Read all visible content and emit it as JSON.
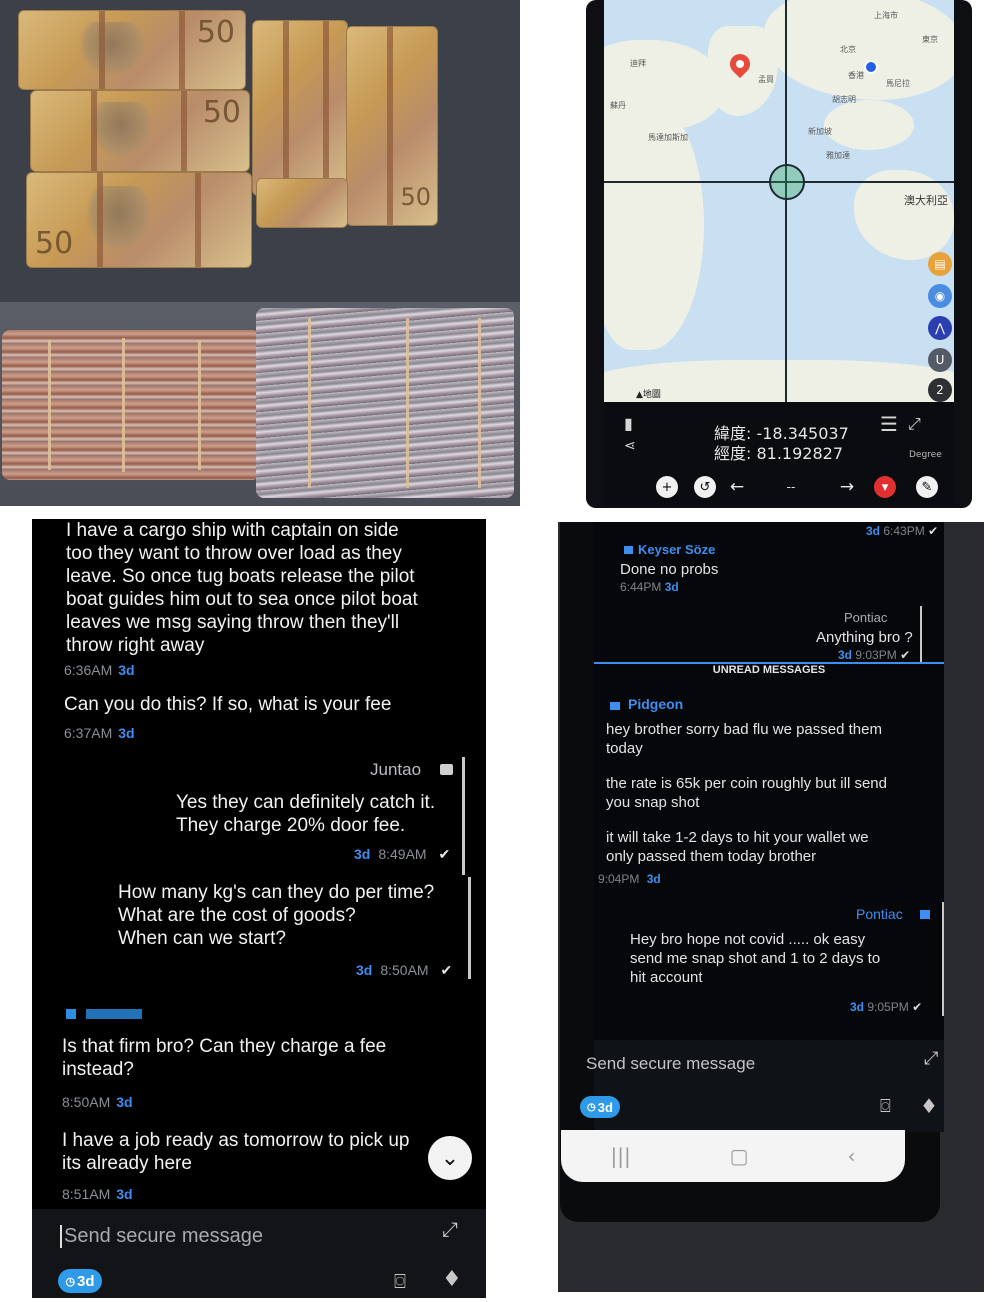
{
  "map": {
    "places": [
      "上海市",
      "東京",
      "北京",
      "香港",
      "胡志明",
      "馬尼拉",
      "新加坡",
      "雅加達",
      "孟買",
      "迪拜",
      "蘇丹",
      "馬達加斯加"
    ],
    "australia_label": "澳大利亞",
    "basemap_label": "▲地圖",
    "latitude_text": "緯度: -18.345037",
    "longitude_text": "經度: 81.192827",
    "degree_label": "Degree",
    "side_buttons": [
      "layers",
      "location",
      "navigate",
      "U",
      "2"
    ],
    "dash_label": "--"
  },
  "chat1": {
    "messages": [
      {
        "lines": [
          "I have a cargo ship with captain on side",
          "too they want to throw over load as they",
          "leave. So once tug boats release the pilot",
          "boat guides him out to sea once pilot boat",
          "leaves we msg saying throw then they'll",
          "throw right away"
        ],
        "time": "6:36AM",
        "ago": "3d"
      },
      {
        "lines": [
          "Can you do this? If so, what is your fee"
        ],
        "time": "6:37AM",
        "ago": "3d"
      },
      {
        "sender": "Juntao",
        "lines": [
          "Yes they can definitely catch it.",
          "They charge 20% door fee."
        ],
        "time": "8:49AM",
        "ago": "3d",
        "status": "✔"
      },
      {
        "lines": [
          "How many kg's can they do per time?",
          "What are the cost of goods?",
          "When can we start?"
        ],
        "time": "8:50AM",
        "ago": "3d",
        "status": "✔"
      },
      {
        "lines": [
          "Is that firm bro? Can they charge a fee",
          "instead?"
        ],
        "time": "8:50AM",
        "ago": "3d"
      },
      {
        "lines": [
          "I have a job ready as tomorrow to pick up",
          "its already here"
        ],
        "time": "8:51AM",
        "ago": "3d"
      }
    ],
    "composer": {
      "placeholder": "Send secure message",
      "timer_badge": "3d"
    }
  },
  "chat2": {
    "top_meta": {
      "ago": "3d",
      "time": "6:43PM"
    },
    "m1": {
      "sender": "Keyser Söze",
      "text": "Done no probs",
      "time": "6:44PM",
      "ago": "3d"
    },
    "m2": {
      "sender": "Pontiac",
      "text": "Anything bro ?",
      "time": "9:03PM",
      "ago": "3d"
    },
    "unread_label": "UNREAD MESSAGES",
    "m3": {
      "sender": "Pidgeon",
      "lines": [
        "hey brother sorry bad flu we passed them",
        "today",
        "the rate is 65k per coin roughly but ill send",
        "you snap shot",
        "it will take 1-2 days to hit your wallet we",
        "only passed them today brother"
      ],
      "time": "9:04PM",
      "ago": "3d"
    },
    "m4": {
      "sender": "Pontiac",
      "lines": [
        "Hey bro hope not covid ..... ok easy",
        "send me snap shot and 1 to 2 days to",
        "hit account"
      ],
      "time": "9:05PM",
      "ago": "3d"
    },
    "composer": {
      "placeholder": "Send secure message",
      "timer_badge": "3d"
    }
  },
  "colors": {
    "accent_blue": "#3d8ef0",
    "badge_blue": "#2f9be8",
    "chat_bg": "#000000",
    "map_water": "#c9dff2"
  }
}
